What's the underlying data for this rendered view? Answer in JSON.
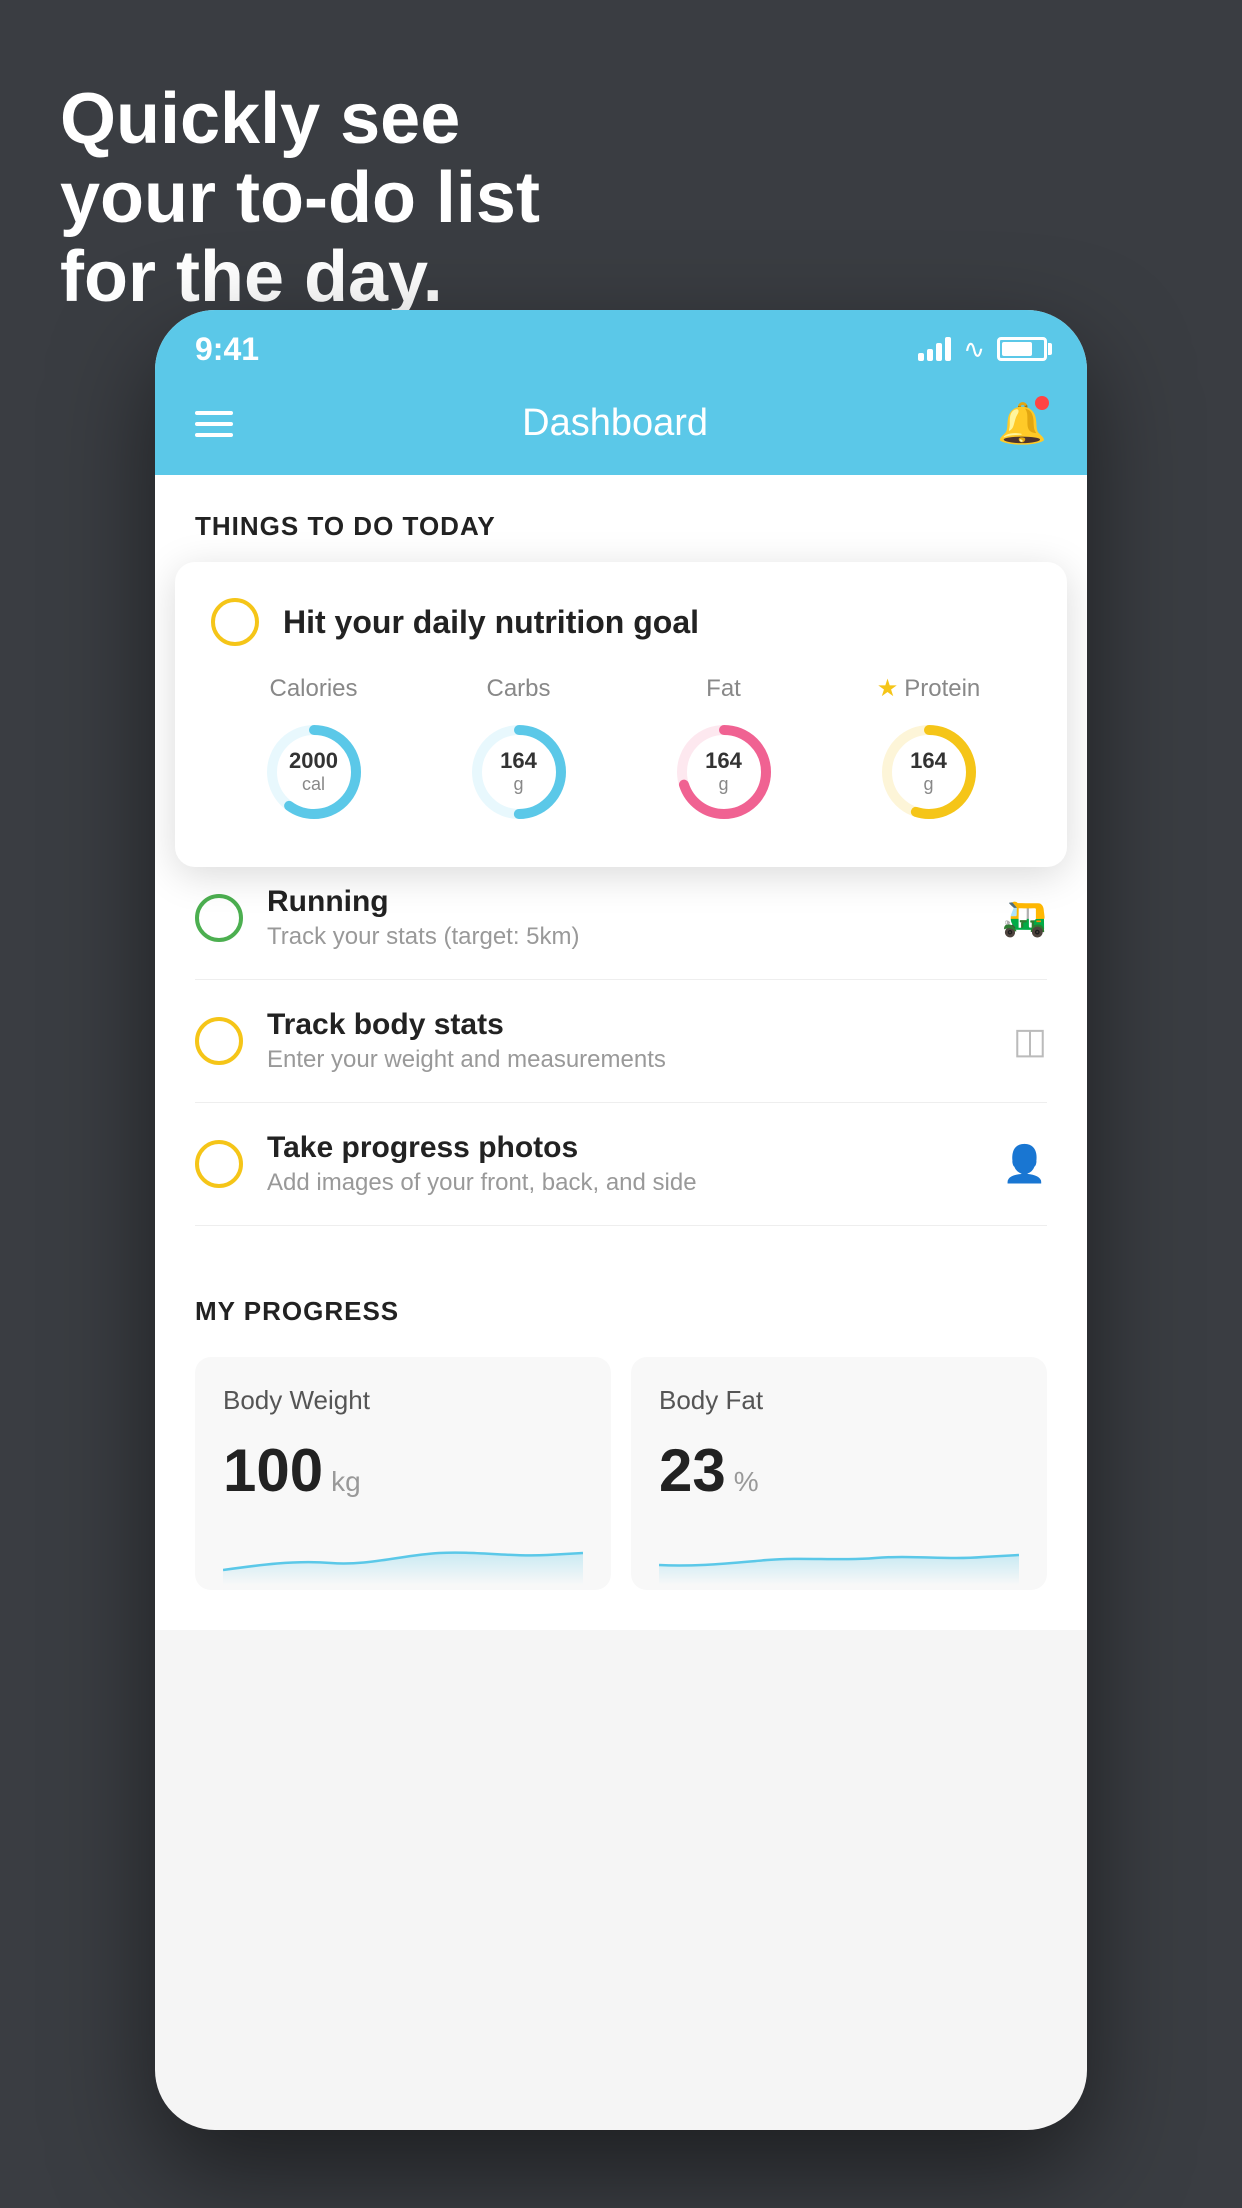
{
  "hero": {
    "line1": "Quickly see",
    "line2": "your to-do list",
    "line3": "for the day."
  },
  "statusBar": {
    "time": "9:41"
  },
  "navBar": {
    "title": "Dashboard"
  },
  "thingsToDo": {
    "sectionTitle": "THINGS TO DO TODAY",
    "nutritionCard": {
      "title": "Hit your daily nutrition goal",
      "metrics": [
        {
          "label": "Calories",
          "value": "2000",
          "unit": "cal",
          "color": "#5bc8e8",
          "progress": 0.6
        },
        {
          "label": "Carbs",
          "value": "164",
          "unit": "g",
          "color": "#5bc8e8",
          "progress": 0.5
        },
        {
          "label": "Fat",
          "value": "164",
          "unit": "g",
          "color": "#f06292",
          "progress": 0.7
        },
        {
          "label": "Protein",
          "value": "164",
          "unit": "g",
          "color": "#f5c518",
          "progress": 0.55,
          "starred": true
        }
      ]
    },
    "items": [
      {
        "title": "Running",
        "subtitle": "Track your stats (target: 5km)",
        "checkColor": "green",
        "iconType": "shoe"
      },
      {
        "title": "Track body stats",
        "subtitle": "Enter your weight and measurements",
        "checkColor": "yellow",
        "iconType": "scale"
      },
      {
        "title": "Take progress photos",
        "subtitle": "Add images of your front, back, and side",
        "checkColor": "yellow",
        "iconType": "person"
      }
    ]
  },
  "progress": {
    "sectionTitle": "MY PROGRESS",
    "cards": [
      {
        "title": "Body Weight",
        "value": "100",
        "unit": "kg"
      },
      {
        "title": "Body Fat",
        "value": "23",
        "unit": "%"
      }
    ]
  }
}
